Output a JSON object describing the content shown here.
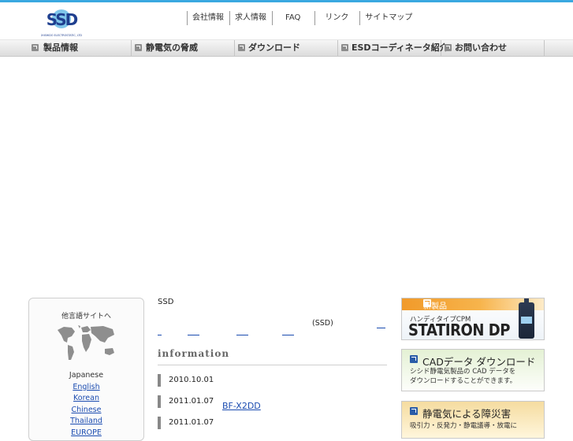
{
  "header": {
    "logo_text": "SSD",
    "logo_subtext": "SHISHIDO ELECTROSTATIC, LTD.",
    "top_links": [
      "会社情報",
      "求人情報",
      "FAQ",
      "リンク",
      "サイトマップ"
    ]
  },
  "nav": {
    "items": [
      "製品情報",
      "静電気の脅威",
      "ダウンロード",
      "ESDコーディネータ紹介",
      "お問い合わせ"
    ]
  },
  "sidebar": {
    "title": "他言語サイトへ",
    "current_language": "Japanese",
    "languages": [
      "English",
      "Korean",
      "Chinese",
      "Thailand",
      "EUROPE"
    ]
  },
  "main": {
    "company_abbr": "SSD",
    "company_paren": "(SSD)",
    "info_heading": "information",
    "news": [
      {
        "date": "2010.10.01",
        "title": ""
      },
      {
        "date": "2011.01.07",
        "title": "BF-X2DD"
      },
      {
        "date": "2011.01.07",
        "title": ""
      }
    ]
  },
  "banners": {
    "new_product": {
      "label": "新製品",
      "sub": "ハンディタイプCPM",
      "product": "STATIRON DP"
    },
    "cad": {
      "title": "CADデータ ダウンロード",
      "desc_line1": "シシド静電気製品の CAD データを",
      "desc_line2": "ダウンロードすることができます。"
    },
    "hazard": {
      "title": "静電気による障災害",
      "desc": "吸引力・反発力・静電議導・放電に"
    }
  },
  "colors": {
    "accent_topline": "#3aa8e0",
    "link": "#1a4bb0",
    "new_product_orange": "#f19a2a",
    "logo_blue": "#1f3f8f"
  }
}
